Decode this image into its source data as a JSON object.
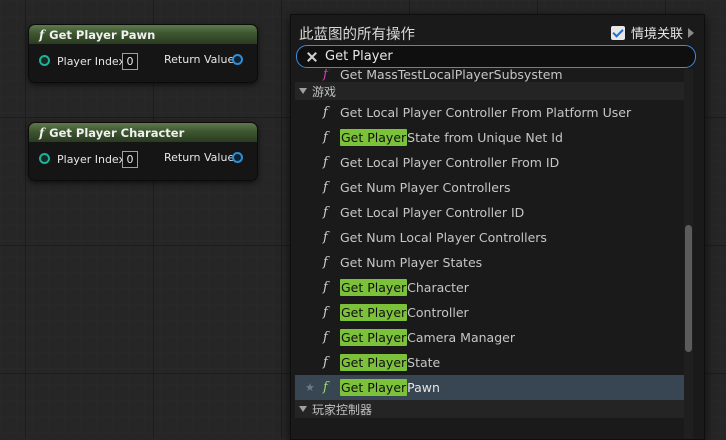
{
  "nodes": [
    {
      "title": "Get Player Pawn",
      "param": "Player Index",
      "value": "0",
      "output": "Return Value"
    },
    {
      "title": "Get Player Character",
      "param": "Player Index",
      "value": "0",
      "output": "Return Value"
    }
  ],
  "menu": {
    "title": "此蓝图的所有操作",
    "context_label": "情境关联",
    "search_value": "Get Player"
  },
  "list": {
    "top_item": "Get MassTestLocalPlayerSubsystem",
    "category_game": "游戏",
    "items": [
      {
        "pre": "",
        "hl": "",
        "post": "Get Local Player Controller From Platform User"
      },
      {
        "pre": "",
        "hl": "Get Player",
        "post": " State from Unique Net Id"
      },
      {
        "pre": "",
        "hl": "",
        "post": "Get Local Player Controller From ID"
      },
      {
        "pre": "",
        "hl": "",
        "post": "Get Num Player Controllers"
      },
      {
        "pre": "",
        "hl": "",
        "post": "Get Local Player Controller ID"
      },
      {
        "pre": "",
        "hl": "",
        "post": "Get Num Local Player Controllers"
      },
      {
        "pre": "",
        "hl": "",
        "post": "Get Num Player States"
      },
      {
        "pre": "",
        "hl": "Get Player",
        "post": " Character"
      },
      {
        "pre": "",
        "hl": "Get Player",
        "post": " Controller"
      },
      {
        "pre": "",
        "hl": "Get Player",
        "post": " Camera Manager"
      },
      {
        "pre": "",
        "hl": "Get Player",
        "post": " State"
      },
      {
        "pre": "",
        "hl": "Get Player",
        "post": " Pawn"
      }
    ],
    "category_player_controller": "玩家控制器"
  },
  "icons": {
    "function": "f",
    "star": "★"
  },
  "colors": {
    "node_pin": "#19b59a",
    "output_pin": "#2a8ed8",
    "highlight": "#7cc13a",
    "selected_row": "#384553",
    "search_border": "#3d8bd9"
  }
}
